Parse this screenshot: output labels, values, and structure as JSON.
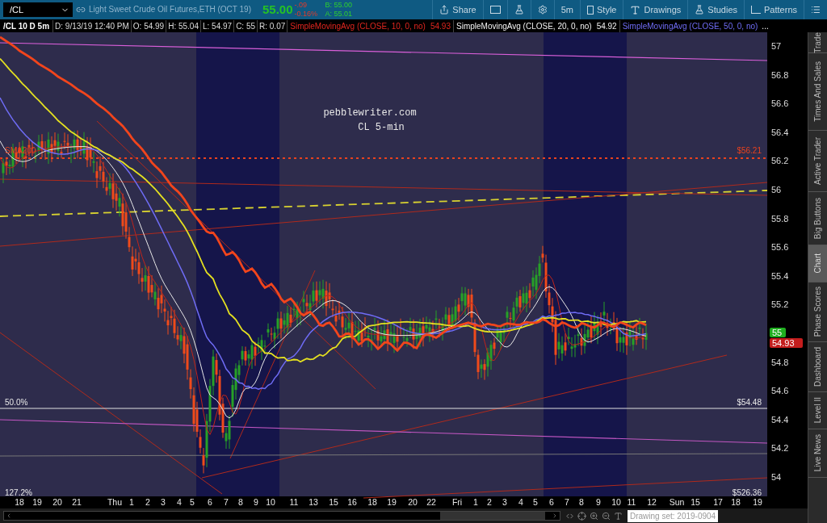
{
  "toolbar": {
    "symbol": "/CL",
    "description": "Light Sweet Crude Oil Futures,ETH (OCT 19)",
    "last": "55.00",
    "change": "-.09",
    "change_pct": "-0.16%",
    "bid": "B: 55.00",
    "ask": "A: 55.01",
    "buttons": [
      "Share",
      "5m",
      "Style",
      "Drawings",
      "Studies",
      "Patterns"
    ]
  },
  "info_bar": {
    "chart_label": "/CL 10 D 5m",
    "fields": [
      "D: 9/13/19 12:40 PM",
      "O: 54.99",
      "H: 55.04",
      "L: 54.97",
      "C: 55",
      "R: 0.07"
    ],
    "studies": [
      {
        "label": "SimpleMovingAvg (CLOSE, 10, 0, no)",
        "value": "54.93",
        "kind": "fast"
      },
      {
        "label": "SimpleMovingAvg (CLOSE, 20, 0, no)",
        "value": "54.92",
        "kind": "medium"
      },
      {
        "label": "SimpleMovingAvg (CLOSE, 50, 0, no)",
        "kind": "slow"
      }
    ],
    "more": "..."
  },
  "chart": {
    "annotation": [
      "pebblewriter.com",
      "CL 5-min"
    ],
    "level_labels": [
      {
        "kind": "left",
        "text": "SMA200"
      },
      {
        "kind": "right",
        "text": "$56.21"
      },
      {
        "kind": "left",
        "text": "50.0%"
      },
      {
        "kind": "right",
        "text": "$54.48"
      },
      {
        "kind": "left",
        "text": "127.2%"
      },
      {
        "kind": "right",
        "text": "$526.36"
      }
    ],
    "price_axis": [
      "57",
      "56.8",
      "56.6",
      "56.4",
      "56.2",
      "56",
      "55.8",
      "55.6",
      "55.4",
      "55.2",
      "54.8",
      "54.6",
      "54.4",
      "54.2",
      "54"
    ],
    "badges": [
      {
        "text": "55",
        "color": "#1fae1f"
      },
      {
        "text": "54.93",
        "color": "#c41d1d"
      }
    ],
    "time_axis": [
      "18",
      "19",
      "20",
      "21",
      "Thu",
      "1",
      "2",
      "3",
      "4",
      "5",
      "6",
      "7",
      "8",
      "9",
      "10",
      "11",
      "13",
      "15",
      "16",
      "18",
      "19",
      "20",
      "22",
      "Fri",
      "1",
      "2",
      "3",
      "4",
      "5",
      "6",
      "7",
      "8",
      "9",
      "10",
      "11",
      "12",
      "Sun",
      "15",
      "17",
      "18",
      "19"
    ]
  },
  "sidebar": [
    {
      "label": "Trade",
      "selected": false
    },
    {
      "label": "Times And Sales",
      "selected": false
    },
    {
      "label": "Active Trader",
      "selected": false
    },
    {
      "label": "Big Buttons",
      "selected": false
    },
    {
      "label": "Chart",
      "selected": true
    },
    {
      "label": "Phase Scores",
      "selected": false
    },
    {
      "label": "Dashboard",
      "selected": false
    },
    {
      "label": "Level II",
      "selected": false
    },
    {
      "label": "Live News",
      "selected": false
    }
  ],
  "footer": {
    "drawing_set": "Drawing set: 2019-0904"
  }
}
